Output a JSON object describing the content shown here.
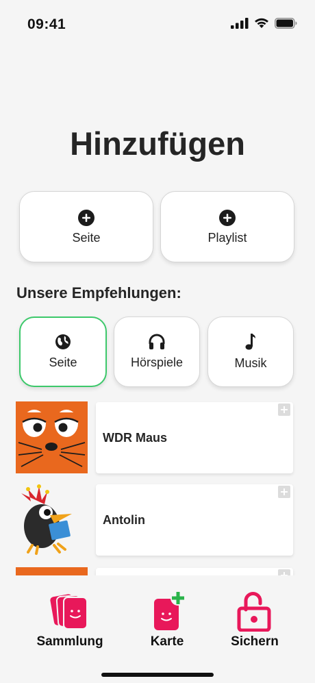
{
  "status": {
    "time": "09:41"
  },
  "page": {
    "title": "Hinzufügen"
  },
  "add_buttons": [
    {
      "label": "Seite",
      "icon": "plus-circle-icon"
    },
    {
      "label": "Playlist",
      "icon": "plus-circle-icon"
    }
  ],
  "recommendations": {
    "title": "Unsere Empfehlungen:",
    "categories": [
      {
        "label": "Seite",
        "icon": "globe-icon",
        "selected": true
      },
      {
        "label": "Hörspiele",
        "icon": "headphones-icon",
        "selected": false
      },
      {
        "label": "Musik",
        "icon": "music-note-icon",
        "selected": false
      }
    ],
    "items": [
      {
        "name": "WDR Maus",
        "thumb": "maus-thumbnail"
      },
      {
        "name": "Antolin",
        "thumb": "raven-thumbnail"
      },
      {
        "name": "",
        "thumb": "orange-thumbnail"
      }
    ]
  },
  "tabbar": [
    {
      "label": "Sammlung",
      "icon": "cards-stack-icon"
    },
    {
      "label": "Karte",
      "icon": "add-card-icon"
    },
    {
      "label": "Sichern",
      "icon": "open-lock-icon"
    }
  ],
  "colors": {
    "accent": "#e8185a",
    "selected_border": "#3cc86a",
    "add_green": "#2ab34a"
  }
}
